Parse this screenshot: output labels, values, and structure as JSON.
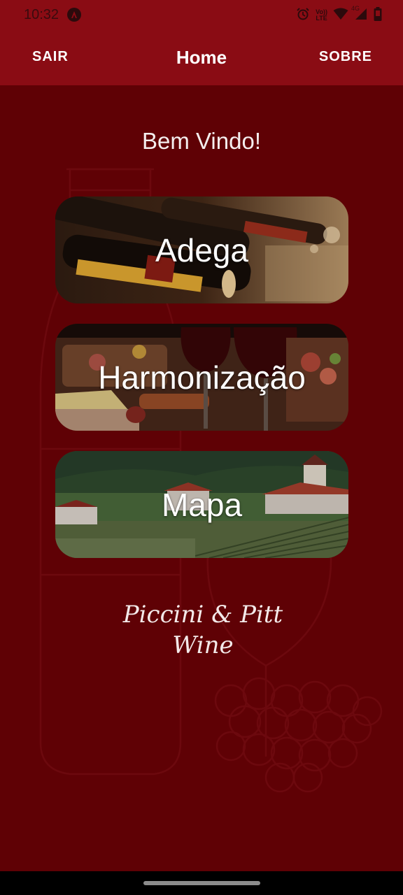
{
  "status_bar": {
    "time": "10:32",
    "icons": [
      "app-notification-icon",
      "alarm-icon",
      "volte-icon",
      "wifi-icon",
      "signal-icon",
      "battery-icon"
    ],
    "volte_top": "Vo))",
    "volte_bottom": "LTE",
    "network": "4G"
  },
  "app_bar": {
    "left_button": "SAIR",
    "title": "Home",
    "right_button": "SOBRE",
    "color": "#8a0c14"
  },
  "main": {
    "welcome": "Bem Vindo!",
    "cards": [
      {
        "label": "Adega"
      },
      {
        "label": "Harmonização"
      },
      {
        "label": "Mapa"
      }
    ]
  },
  "logo": {
    "line1": "Piccini & Pitt",
    "line2": "Wine"
  },
  "colors": {
    "background": "#5f0105",
    "app_bar": "#8a0c14",
    "text": "#ffffff"
  }
}
